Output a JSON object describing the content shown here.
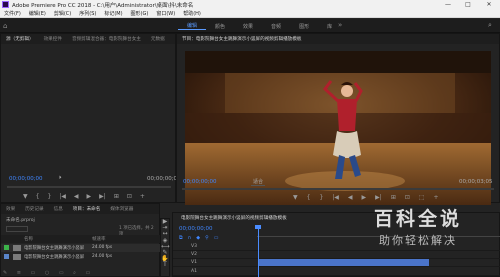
{
  "window": {
    "title": "Adobe Premiere Pro CC 2018 - C:\\用户\\Administrator\\桌面\\抖\\未命名",
    "minimize": "—",
    "maximize": "□",
    "close": "✕"
  },
  "menu": [
    "文件(F)",
    "编辑(E)",
    "剪辑(C)",
    "序列(S)",
    "标记(M)",
    "图形(G)",
    "窗口(W)",
    "帮助(H)"
  ],
  "workspaces": {
    "tabs": [
      "编辑",
      "颜色",
      "效果",
      "音频",
      "图形",
      "库"
    ],
    "active_index": 0,
    "more": "»"
  },
  "source_panel": {
    "tabs": [
      "源（无剪辑）",
      "效果控件",
      "音频剪辑混合器：电影院舞台女主",
      "元数据"
    ],
    "timecode": "00;00;00;00",
    "fit_control": "⏵",
    "end_timecode": "00;00;00;00",
    "controls": [
      "▼",
      "{",
      "}",
      "|◀",
      "◀",
      "▶",
      "▶|",
      "⊞",
      "⊡",
      "+"
    ]
  },
  "program_panel": {
    "tab": "节目：电影院舞台女主跳舞演示小竖屏的视频剪辑播放模板",
    "timecode": "00;00;00;00",
    "fit": "适合",
    "end_timecode": "00;00;03;05",
    "controls": [
      "▼",
      "{",
      "}",
      "|◀",
      "◀",
      "▶",
      "▶|",
      "⊞",
      "⊡",
      "⬚",
      "+"
    ]
  },
  "project_panel": {
    "tabs": [
      "效果",
      "历史记录",
      "信息",
      "项目：未命名",
      "媒体浏览器"
    ],
    "project_name": "未命名.prproj",
    "item_count": "1 项已选择，共 2 项",
    "columns": [
      "名称",
      "帧速率"
    ],
    "rows": [
      {
        "name": "电影院舞台女主跳舞演示小竖屏",
        "fps": "24.00 fps",
        "color": "#3cb34a"
      },
      {
        "name": "电影院舞台女主跳舞演示小竖屏",
        "fps": "24.00 fps",
        "color": "#5a85c9"
      }
    ],
    "bottom_icons": "✎ ≡ ▭ ○ ▭ ⌕ ▭"
  },
  "tools": [
    "▶",
    "⇥",
    "↔",
    "◈",
    "⟷",
    "✎",
    "✋",
    "T"
  ],
  "timeline": {
    "title": "电影院舞台女主跳舞演示小竖屏的视频剪辑播放模板",
    "timecode": "00;00;00;00",
    "icons": [
      "⧉",
      "∩",
      "◆",
      "⚲",
      "▭"
    ],
    "tracks": [
      "V3",
      "V2",
      "V1",
      "A1"
    ],
    "clip_color": "#4a74c9"
  },
  "watermark": {
    "title": "百科全说",
    "subtitle": "助你轻松解决"
  }
}
